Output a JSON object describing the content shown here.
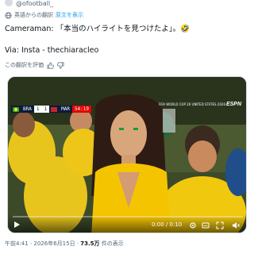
{
  "header": {
    "handle": "@ofootball_"
  },
  "translation": {
    "label": "英語からの翻訳",
    "show_original": "原文を表示"
  },
  "tweet": {
    "text": "Cameraman: 「本当のハイライトを見つけたよ」。🤣",
    "via": "Via: Insta - thechiaracleo"
  },
  "rating": {
    "label": "この翻訳を評価"
  },
  "video": {
    "scorebug": {
      "team_home": "BRA",
      "score_home": "1",
      "score_away": "1",
      "team_away": "MAR",
      "clock": "54:19"
    },
    "broadcaster": "ESPN",
    "event_logo": "FIFA WORLD CUP 26 UNITED STATES 2026",
    "time_display": "0:00 / 0:10",
    "progress_fraction": 0
  },
  "meta": {
    "timestamp": "午前4:41 · 2026年6月15日 · ",
    "views_count": "73.5万",
    "views_suffix": " 件の表示"
  },
  "colors": {
    "accent": "#1d9bf0",
    "text": "#0f1419",
    "muted": "#536471"
  }
}
